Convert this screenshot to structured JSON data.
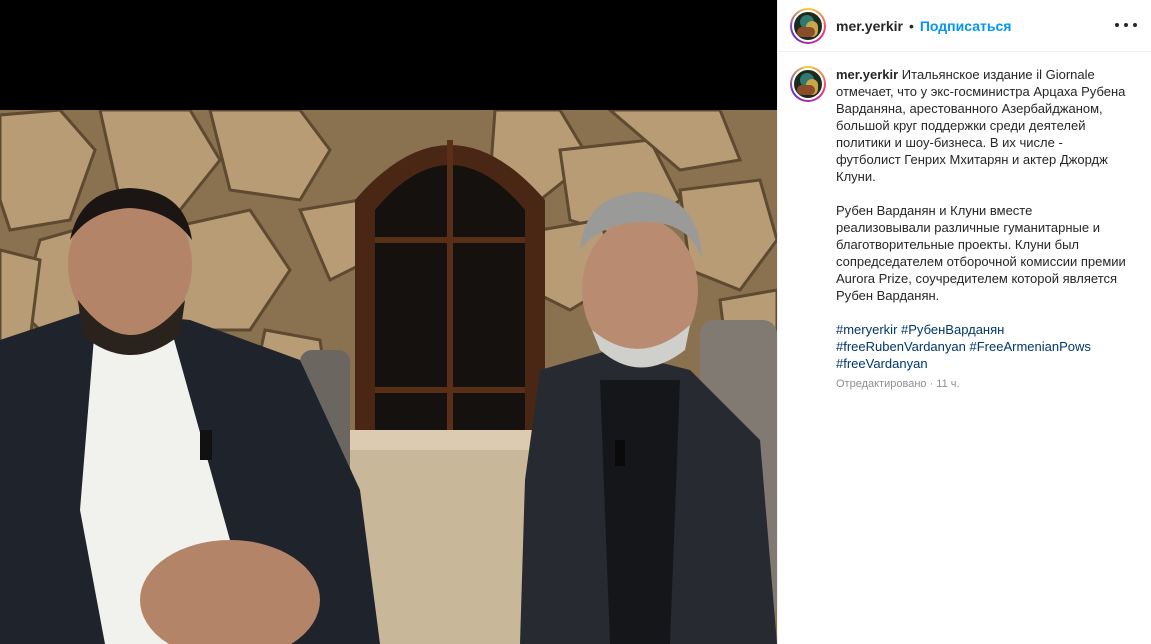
{
  "post": {
    "username": "mer.yerkir",
    "separator": "•",
    "follow_label": "Подписаться",
    "caption_text_1": "Итальянское издание il Giornale отмечает, что у экс-госминистра Арцаха Рубена Варданяна, арестованного Азербайджаном, большой круг поддержки среди деятелей политики и шоу-бизнеса. В их числе - футболист Генрих Мхитарян и актер Джордж Клуни.",
    "caption_text_2": "Рубен Варданян и Клуни вместе реализовывали различные гуманитарные и благотворительные проекты. Клуни был сопредседателем отборочной комиссии премии Aurora Prize, соучредителем которой является Рубен Варданян.",
    "hashtags": [
      "#meryerkir",
      "#РубенВарданян",
      "#freeRubenVardanyan",
      "#FreeArmenianPows",
      "#freeVardanyan"
    ],
    "edited_label": "Отредактировано",
    "time_ago": "11 ч."
  },
  "colors": {
    "follow": "#0095f6",
    "hashtag": "#00376b",
    "meta": "#8e8e8e"
  },
  "icons": {
    "more": "more-options-icon"
  }
}
